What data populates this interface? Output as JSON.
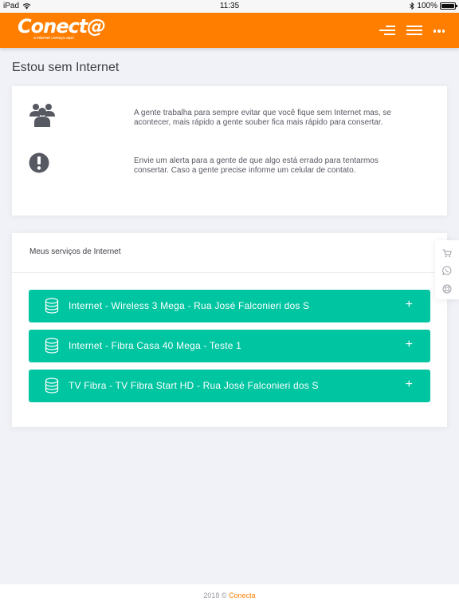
{
  "status_bar": {
    "device": "iPad",
    "time": "11:35",
    "battery": "100%",
    "battery_level": 1.0
  },
  "header": {
    "logo": "Conect@",
    "tagline": "a internet começa aqui",
    "brand_color": "#ff7e00",
    "icons": [
      "menu-left-icon",
      "menu-icon",
      "more-dots-icon"
    ]
  },
  "page": {
    "title": "Estou sem Internet"
  },
  "info": {
    "items": [
      {
        "icon": "users-icon",
        "text": "A gente trabalha para sempre evitar que você fique sem Internet mas, se acontecer, mais rápido a gente souber fica mais rápido para consertar."
      },
      {
        "icon": "exclamation-circle-icon",
        "text": "Envie um alerta para a gente de que algo está errado para tentarmos consertar. Caso a gente precise informe um celular de contato."
      }
    ]
  },
  "services": {
    "title": "Meus serviços de Internet",
    "accent_color": "#00c5a1",
    "items": [
      {
        "label": "Internet - Wireless 3 Mega - Rua José Falconieri dos S",
        "action": "+"
      },
      {
        "label": "Internet - Fibra Casa 40 Mega - Teste 1",
        "action": "+"
      },
      {
        "label": "TV Fibra - TV Fibra Start HD - Rua José Falconieri dos S",
        "action": "+"
      }
    ]
  },
  "quick_actions": [
    "cart-icon",
    "whatsapp-icon",
    "support-icon"
  ],
  "footer": {
    "prefix": "2018 ©",
    "brand": "Conecta"
  }
}
